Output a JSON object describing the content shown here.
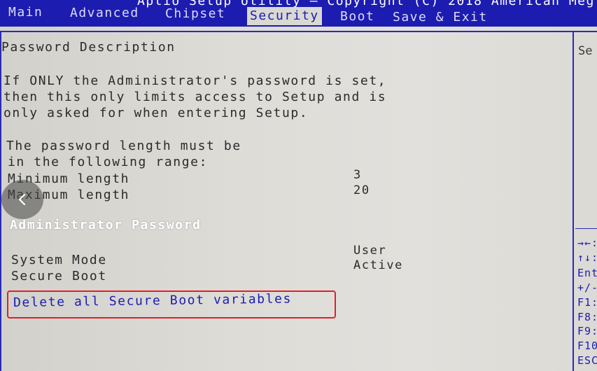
{
  "window": {
    "title": "Aptio Setup Utility – Copyright (C) 2018 American Meg"
  },
  "tabs": [
    {
      "label": "Main",
      "active": false
    },
    {
      "label": "Advanced",
      "active": false
    },
    {
      "label": "Chipset",
      "active": false
    },
    {
      "label": "Security",
      "active": true
    },
    {
      "label": "Boot",
      "active": false
    },
    {
      "label": "Save & Exit",
      "active": false
    }
  ],
  "main": {
    "section_title": "Password Description",
    "description": [
      "If ONLY the Administrator's password is set,",
      "then this only limits access to Setup and is",
      "only asked for when entering Setup."
    ],
    "length_note": [
      "The password length must be",
      "in the following range:"
    ],
    "min_length": {
      "label": "Minimum length",
      "value": "3"
    },
    "max_length": {
      "label": "Maximum length",
      "value": "20"
    },
    "admin_password": "Administrator Password",
    "system_mode": {
      "label": "System Mode",
      "value": "User"
    },
    "secure_boot": {
      "label": "Secure Boot",
      "value": "Active"
    },
    "delete_keys": "Delete all Secure Boot variables"
  },
  "help": {
    "title": "Se",
    "keys": [
      "→←:",
      "↑↓:",
      "Ent",
      "+/-",
      "F1:",
      "F8:",
      "F9:",
      "F10",
      "ESC"
    ]
  },
  "colors": {
    "bios_blue": "#1c1cb0",
    "background": "#d9d8d3",
    "highlight_box": "#e0202a"
  }
}
